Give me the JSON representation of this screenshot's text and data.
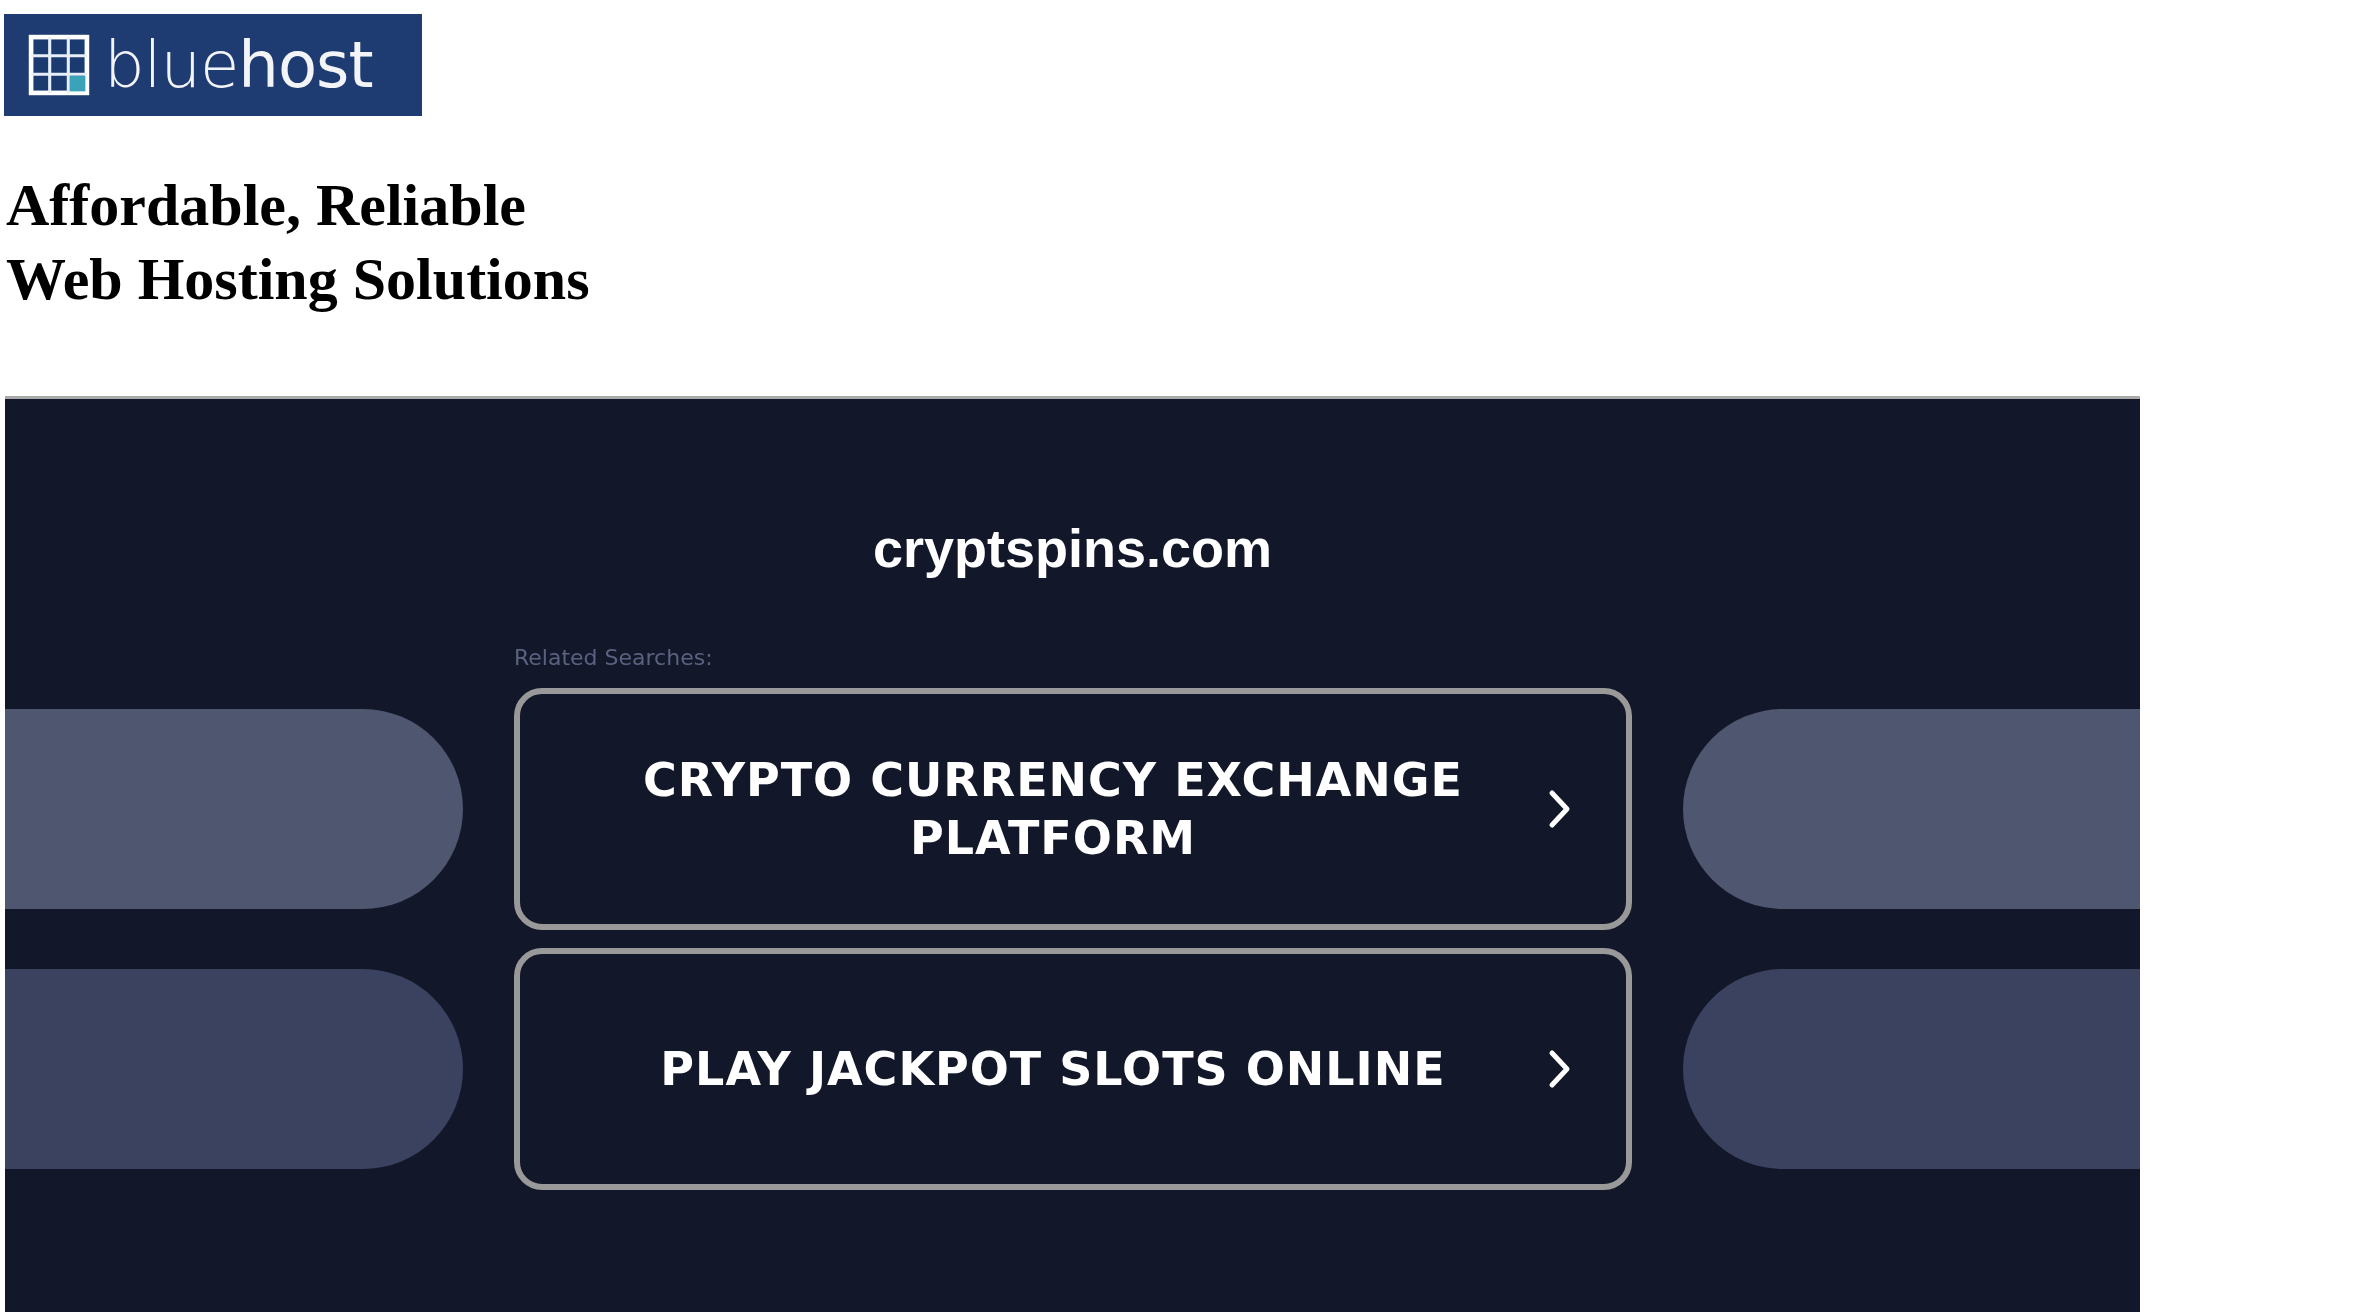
{
  "logo": {
    "text": "blue**host**"
  },
  "headline": [
    "Affordable, Reliable",
    "Web Hosting Solutions"
  ],
  "parked_page": {
    "domain": "cryptspins.com",
    "related_label": "Related Searches:",
    "searches": [
      {
        "label": "CRYPTO CURRENCY EXCHANGE PLATFORM"
      },
      {
        "label": "PLAY JACKPOT SLOTS ONLINE"
      }
    ]
  }
}
